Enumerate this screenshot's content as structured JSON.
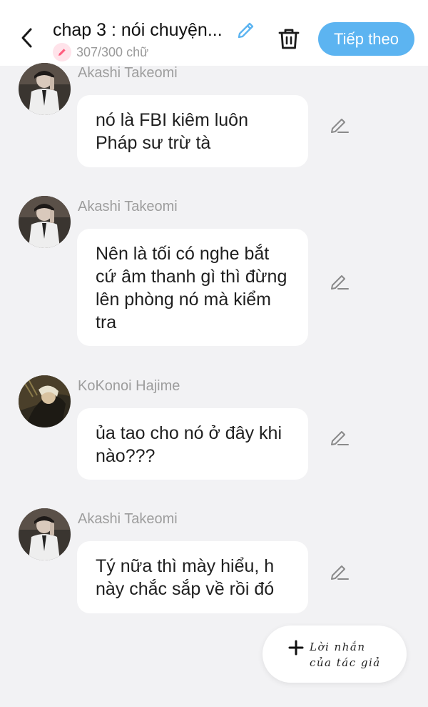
{
  "header": {
    "title": "chap 3 : nói chuyện...",
    "word_count": "307/300 chữ",
    "next_label": "Tiếp theo",
    "accent_color": "#5cb4f1"
  },
  "messages": [
    {
      "sender": "Akashi Takeomi",
      "text": "nó là FBI kiêm luôn Pháp sư trừ tà",
      "avatar": "avatar-akashi"
    },
    {
      "sender": "Akashi Takeomi",
      "text": "Nên là tối có nghe bắt cứ âm thanh gì thì đừng lên phòng nó mà kiểm tra",
      "avatar": "avatar-akashi"
    },
    {
      "sender": "KoKonoi Hajime",
      "text": "ủa tao cho nó ở đây khi nào???",
      "avatar": "avatar-kokonoi"
    },
    {
      "sender": "Akashi Takeomi",
      "text": "Tý nữa thì mày hiểu, h này chắc sắp về rồi đó",
      "avatar": "avatar-akashi"
    }
  ],
  "author_note": {
    "label": "Lời nhắn\ncủa tác giả"
  },
  "icons": {
    "back": "chevron-left-icon",
    "edit": "pencil-icon",
    "trash": "trash-icon",
    "plus": "plus-icon"
  }
}
